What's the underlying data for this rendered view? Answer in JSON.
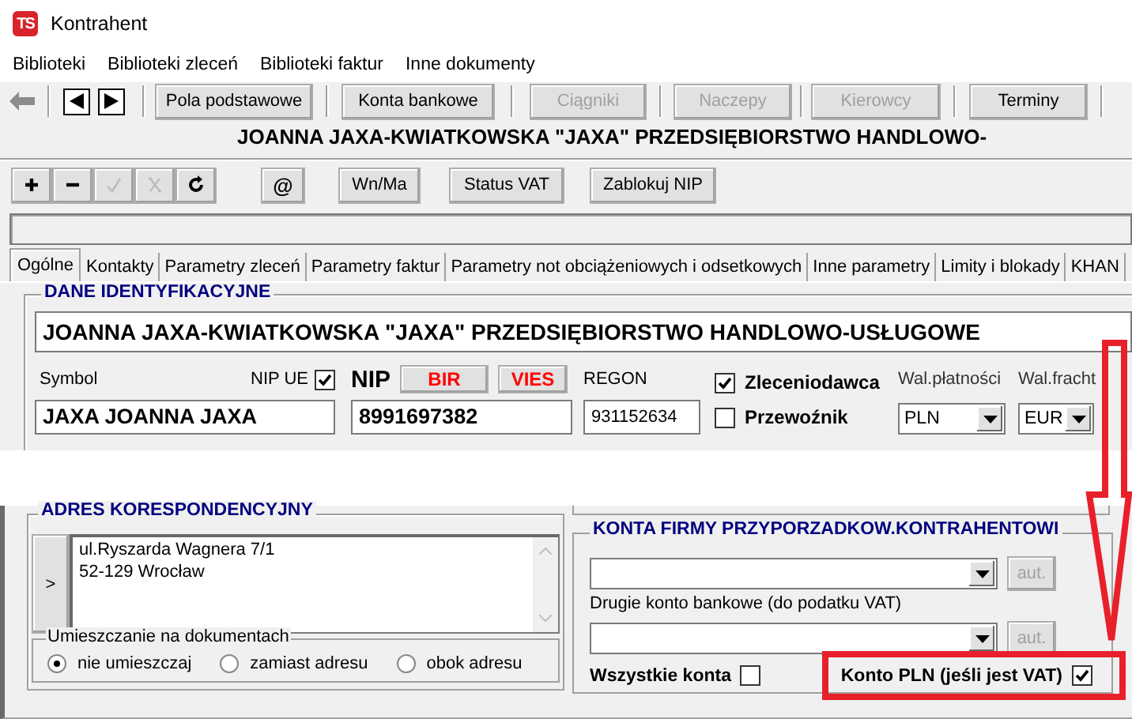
{
  "window": {
    "logo": "TS",
    "title": "Kontrahent"
  },
  "menu": [
    "Biblioteki",
    "Biblioteki zleceń",
    "Biblioteki faktur",
    "Inne dokumenty"
  ],
  "toolbar": {
    "nav": [
      {
        "kind": "prev"
      },
      {
        "kind": "next"
      }
    ],
    "buttons": [
      {
        "label": "Pola podstawowe",
        "disabled": false
      },
      {
        "label": "Konta bankowe",
        "disabled": false
      },
      {
        "label": "Ciągniki",
        "disabled": true
      },
      {
        "label": "Naczepy",
        "disabled": true
      },
      {
        "label": "Kierowcy",
        "disabled": true
      },
      {
        "label": "Terminy",
        "disabled": false
      }
    ]
  },
  "header": "JOANNA JAXA-KWIATKOWSKA \"JAXA\" PRZEDSIĘBIORSTWO HANDLOWO-",
  "edit_toolbar": {
    "icons": [
      {
        "kind": "plus",
        "disabled": false
      },
      {
        "kind": "minus",
        "disabled": false
      },
      {
        "kind": "check",
        "disabled": true
      },
      {
        "kind": "cross",
        "disabled": true
      },
      {
        "kind": "refresh",
        "disabled": false
      }
    ],
    "buttons": [
      "@",
      "Wn/Ma",
      "Status VAT",
      "Zablokuj NIP"
    ]
  },
  "tabs": [
    {
      "label": "Ogólne",
      "selected": true
    },
    {
      "label": "Kontakty",
      "selected": false
    },
    {
      "label": "Parametry zleceń",
      "selected": false
    },
    {
      "label": "Parametry faktur",
      "selected": false
    },
    {
      "label": "Parametry not obciążeniowych i odsetkowych",
      "selected": false
    },
    {
      "label": "Inne parametry",
      "selected": false
    },
    {
      "label": "Limity i blokady",
      "selected": false
    },
    {
      "label": "KHAN",
      "selected": false
    }
  ],
  "identification": {
    "title": "DANE IDENTYFIKACYJNE",
    "name": "JOANNA JAXA-KWIATKOWSKA \"JAXA\" PRZEDSIĘBIORSTWO HANDLOWO-USŁUGOWE",
    "symbol_label": "Symbol",
    "symbol": "JAXA JOANNA JAXA",
    "nip_ue": {
      "label": "NIP UE",
      "checked": true
    },
    "nip_label": "NIP",
    "bir": "BIR",
    "vies": "VIES",
    "nip": "8991697382",
    "regon_label": "REGON",
    "regon": "931152634",
    "roles": [
      {
        "label": "Zleceniodawca",
        "checked": true
      },
      {
        "label": "Przewoźnik",
        "checked": false
      }
    ],
    "payment_currency": {
      "label": "Wal.płatności",
      "value": "PLN"
    },
    "freight_currency": {
      "label": "Wal.fracht",
      "value": "EUR"
    }
  },
  "address": {
    "title": "ADRES KORESPONDENCYJNY",
    "expand": ">",
    "lines": [
      "ul.Ryszarda Wagnera 7/1",
      "52-129 Wrocław"
    ],
    "placement": {
      "title": "Umieszczanie na dokumentach",
      "options": [
        {
          "label": "nie umieszczaj",
          "selected": true
        },
        {
          "label": "zamiast adresu",
          "selected": false
        },
        {
          "label": "obok adresu",
          "selected": false
        }
      ]
    }
  },
  "accounts": {
    "title": "KONTA FIRMY PRZYPORZADKOW.KONTRAHENTOWI",
    "auto_buttons": [
      "aut.",
      "aut."
    ],
    "second_label": "Drugie konto bankowe (do podatku VAT)",
    "all_accounts": {
      "label": "Wszystkie konta",
      "checked": false
    },
    "pln_account": {
      "label": "Konto PLN (jeśli jest VAT)",
      "checked": true
    }
  }
}
